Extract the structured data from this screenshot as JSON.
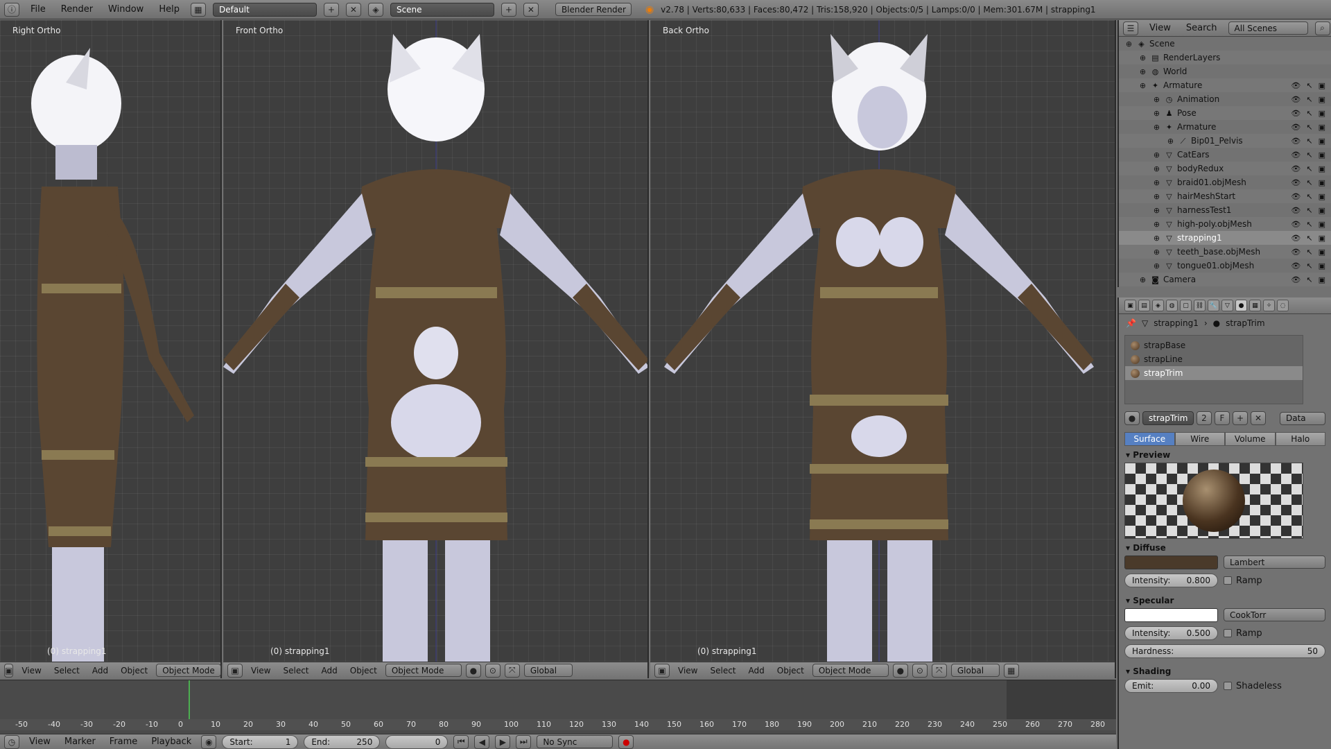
{
  "topbar": {
    "menu": [
      "File",
      "Render",
      "Window",
      "Help"
    ],
    "layout": "Default",
    "scene": "Scene",
    "engine": "Blender Render",
    "stats": "v2.78 | Verts:80,633 | Faces:80,472 | Tris:158,920 | Objects:0/5 | Lamps:0/0 | Mem:301.67M | strapping1"
  },
  "viewports": [
    {
      "label": "Right Ortho",
      "object": "(0) strapping1"
    },
    {
      "label": "Front Ortho",
      "object": "(0) strapping1"
    },
    {
      "label": "Back Ortho",
      "object": "(0) strapping1"
    }
  ],
  "viewport_header": {
    "menu": [
      "View",
      "Select",
      "Add",
      "Object"
    ],
    "mode": "Object Mode",
    "orientation": "Global"
  },
  "timeline": {
    "ticks": [
      "-50",
      "-40",
      "-30",
      "-20",
      "-10",
      "0",
      "10",
      "20",
      "30",
      "40",
      "50",
      "60",
      "70",
      "80",
      "90",
      "100",
      "110",
      "120",
      "130",
      "140",
      "150",
      "160",
      "170",
      "180",
      "190",
      "200",
      "210",
      "220",
      "230",
      "240",
      "250",
      "260",
      "270",
      "280"
    ],
    "menu": [
      "View",
      "Marker",
      "Frame",
      "Playback"
    ],
    "start_label": "Start:",
    "start": "1",
    "end_label": "End:",
    "end": "250",
    "current": "0",
    "sync": "No Sync"
  },
  "outliner": {
    "menu": [
      "View",
      "Search"
    ],
    "scenes": "All Scenes",
    "rows": [
      {
        "label": "Scene",
        "indent": 0,
        "icon": "◈"
      },
      {
        "label": "RenderLayers",
        "indent": 1,
        "icon": "▤"
      },
      {
        "label": "World",
        "indent": 1,
        "icon": "◍"
      },
      {
        "label": "Armature",
        "indent": 1,
        "icon": "✦"
      },
      {
        "label": "Animation",
        "indent": 2,
        "icon": "◷"
      },
      {
        "label": "Pose",
        "indent": 2,
        "icon": "♟"
      },
      {
        "label": "Armature",
        "indent": 2,
        "icon": "✦"
      },
      {
        "label": "Bip01_Pelvis",
        "indent": 3,
        "icon": "⟋"
      },
      {
        "label": "CatEars",
        "indent": 2,
        "icon": "▽"
      },
      {
        "label": "bodyRedux",
        "indent": 2,
        "icon": "▽"
      },
      {
        "label": "braid01.objMesh",
        "indent": 2,
        "icon": "▽"
      },
      {
        "label": "hairMeshStart",
        "indent": 2,
        "icon": "▽"
      },
      {
        "label": "harnessTest1",
        "indent": 2,
        "icon": "▽"
      },
      {
        "label": "high-poly.objMesh",
        "indent": 2,
        "icon": "▽"
      },
      {
        "label": "strapping1",
        "indent": 2,
        "icon": "▽",
        "selected": true
      },
      {
        "label": "teeth_base.objMesh",
        "indent": 2,
        "icon": "▽"
      },
      {
        "label": "tongue01.objMesh",
        "indent": 2,
        "icon": "▽"
      },
      {
        "label": "Camera",
        "indent": 1,
        "icon": "◙"
      }
    ]
  },
  "properties": {
    "breadcrumb_object": "strapping1",
    "breadcrumb_material": "strapTrim",
    "slots": [
      "strapBase",
      "strapLine",
      "strapTrim"
    ],
    "material_name": "strapTrim",
    "users": "2",
    "fake": "F",
    "link": "Data",
    "tabs": [
      "Surface",
      "Wire",
      "Volume",
      "Halo"
    ],
    "preview_title": "Preview",
    "diffuse_title": "Diffuse",
    "diffuse_shader": "Lambert",
    "diffuse_color": "#4a3a2a",
    "intensity_label": "Intensity:",
    "diffuse_intensity": "0.800",
    "ramp_label": "Ramp",
    "specular_title": "Specular",
    "specular_shader": "CookTorr",
    "specular_intensity": "0.500",
    "hardness_label": "Hardness:",
    "hardness": "50",
    "shading_title": "Shading",
    "emit_label": "Emit:",
    "emit": "0.00",
    "shadeless_label": "Shadeless"
  }
}
